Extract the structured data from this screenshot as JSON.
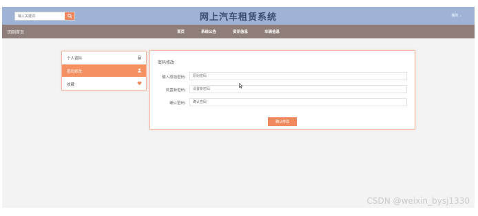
{
  "app": {
    "title": "网上汽车租赁系统"
  },
  "search": {
    "placeholder": "输入关键词",
    "icon": "search-icon"
  },
  "header": {
    "user_label": "我的 ⌄"
  },
  "nav": {
    "home": "回到首页",
    "items": [
      {
        "label": "首页"
      },
      {
        "label": "系统公告"
      },
      {
        "label": "资讯信息"
      },
      {
        "label": "车辆信息"
      }
    ]
  },
  "sidebar": {
    "items": [
      {
        "label": "个人资料",
        "icon": "lock-icon",
        "active": false
      },
      {
        "label": "密码修改",
        "icon": "user-icon",
        "active": true
      },
      {
        "label": "收藏",
        "icon": "heart-icon",
        "active": false
      }
    ]
  },
  "form": {
    "title": "密码修改",
    "fields": [
      {
        "label": "输入原始密码:",
        "placeholder": "原始密码",
        "value": ""
      },
      {
        "label": "设置新密码:",
        "placeholder": "设置新密码",
        "value": ""
      },
      {
        "label": "确认密码:",
        "placeholder": "确认密码",
        "value": ""
      }
    ],
    "submit_label": "确认修改"
  },
  "watermark": "CSDN @weixin_bysj1330",
  "colors": {
    "accent": "#f08a5e",
    "topbar": "#9eb3d6",
    "navbar": "#8e7d78"
  }
}
